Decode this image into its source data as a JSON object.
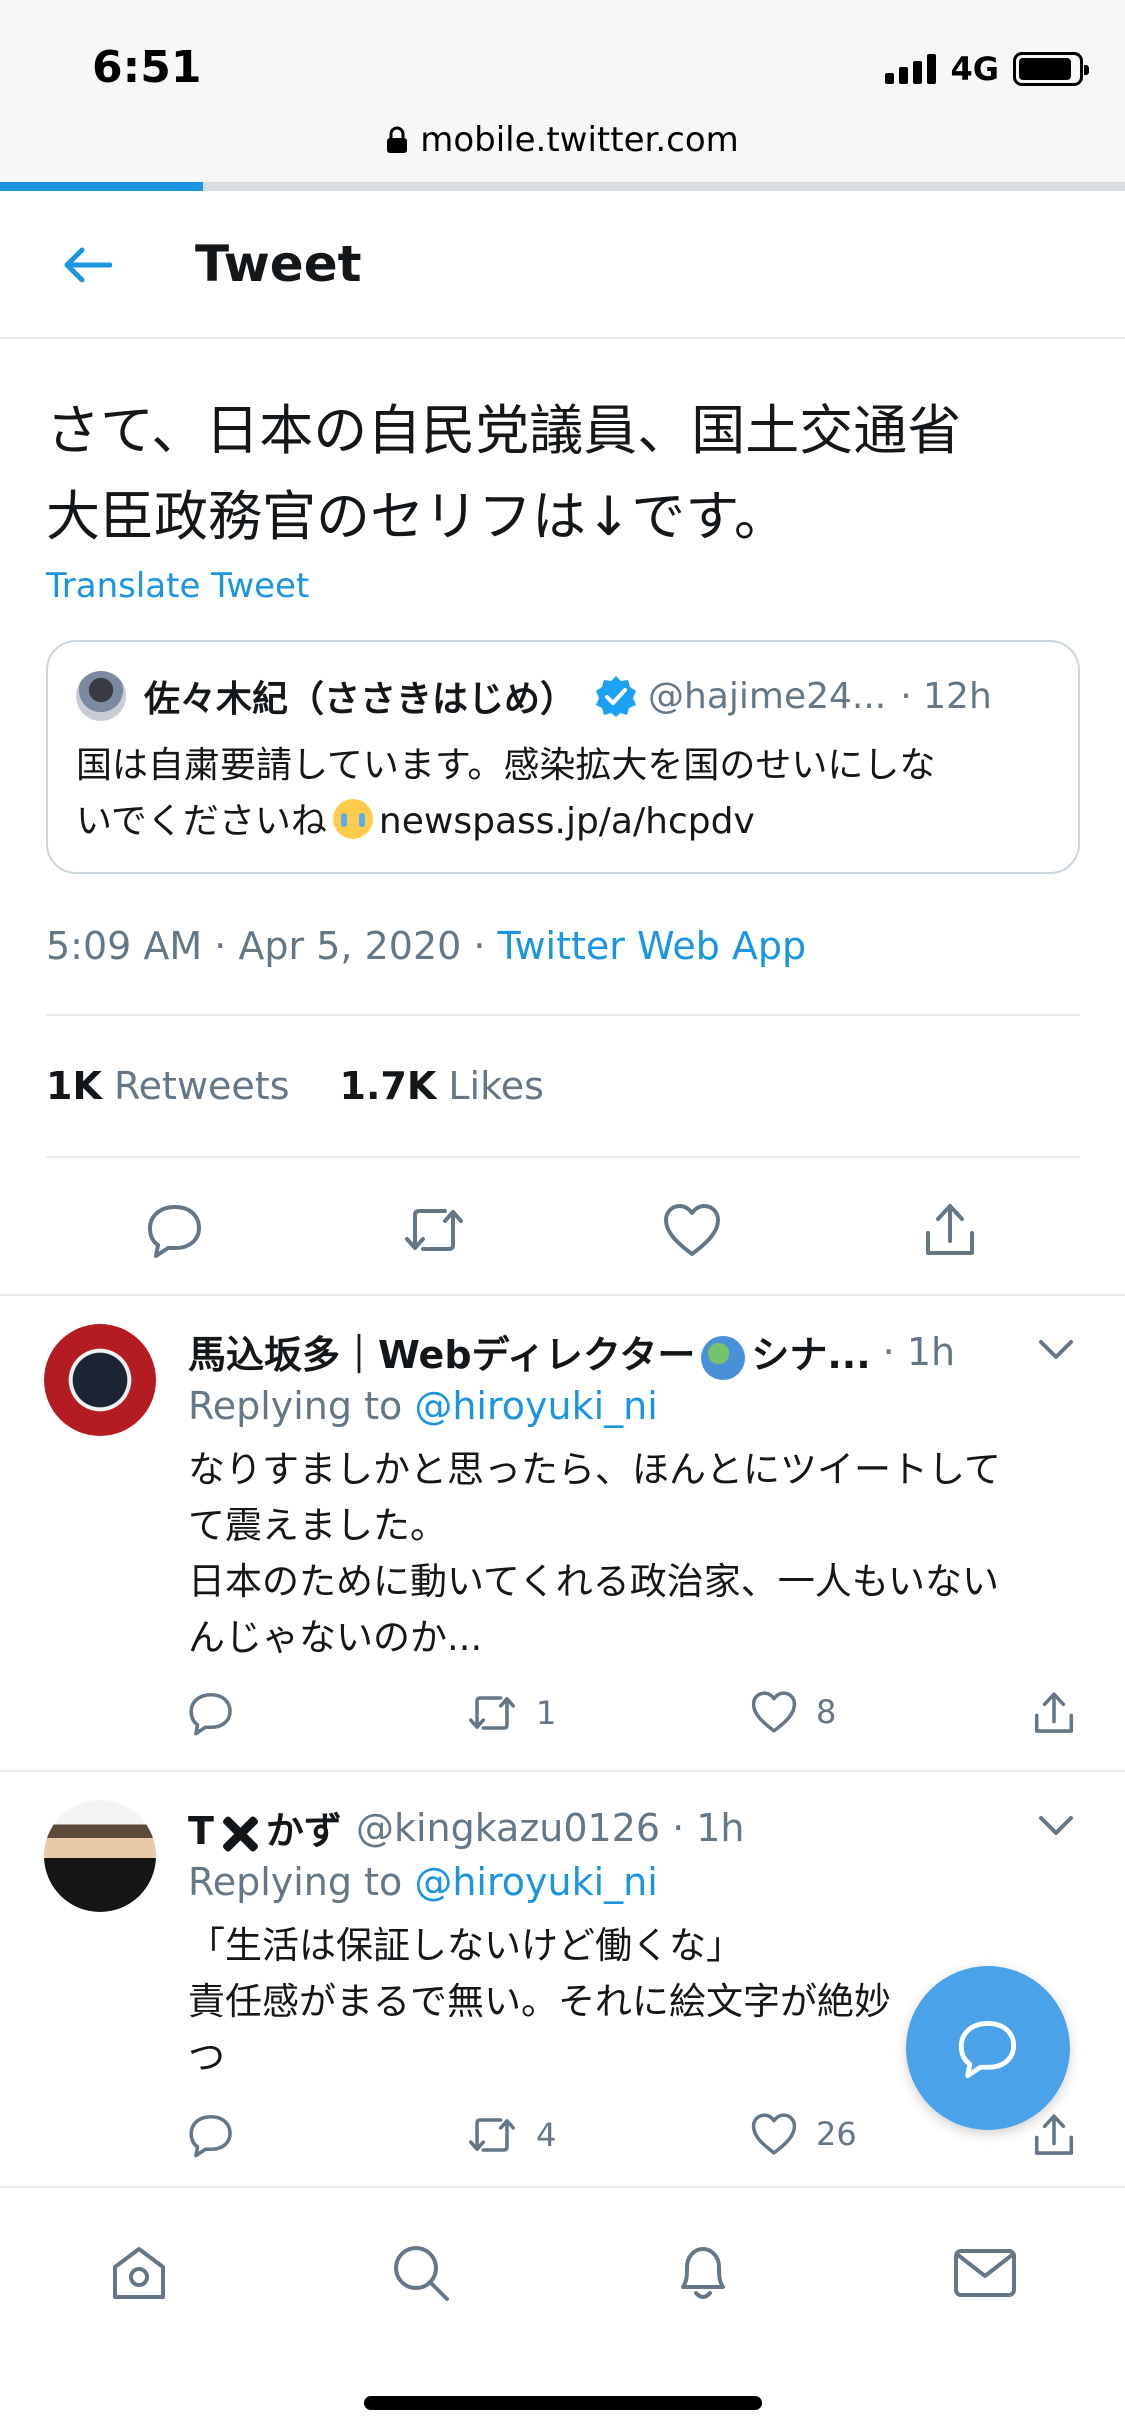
{
  "status_bar": {
    "time": "6:51",
    "network": "4G",
    "battery_level": 0.9
  },
  "browser": {
    "url": "mobile.twitter.com",
    "load_progress": 0.18
  },
  "header": {
    "title": "Tweet"
  },
  "tweet": {
    "text_line1": "さて、日本の自民党議員、国土交通省",
    "text_line2": "大臣政務官のセリフは↓です。",
    "translate_label": "Translate Tweet",
    "quote": {
      "name": "佐々木紀（ささきはじめ）",
      "handle": "@hajime24...",
      "time": "· 12h",
      "body_line1": "国は自粛要請しています。感染拡大を国のせいにしな",
      "body_line2_prefix": "いでくださいね",
      "link": "newspass.jp/a/hcpdv"
    },
    "timestamp": "5:09 AM · Apr 5, 2020 · ",
    "source_app": "Twitter Web App",
    "retweets_count": "1K",
    "retweets_label": "Retweets",
    "likes_count": "1.7K",
    "likes_label": "Likes"
  },
  "replies": [
    {
      "name_part1": "馬込坂多｜Webディレクター",
      "name_part2": "シナ...",
      "handle": "",
      "time": "· 1h",
      "replying_prefix": "Replying to ",
      "replying_to": "@hiroyuki_ni",
      "body": "なりすましかと思ったら、ほんとにツイートして\nて震えました。\n日本のために動いてくれる政治家、一人もいない\nんじゃないのか...",
      "retweets": "1",
      "likes": "8"
    },
    {
      "name_part1": "T",
      "name_part2": "かず",
      "handle": "@kingkazu0126",
      "time": "· 1h",
      "replying_prefix": "Replying to ",
      "replying_to": "@hiroyuki_ni",
      "body": "「生活は保証しないけど働くな」\n責任感がまるで無い。それに絵文字が絶妙\nつ",
      "retweets": "4",
      "likes": "26"
    }
  ],
  "icons": {
    "back": "arrow-left-icon",
    "reply": "reply-icon",
    "retweet": "retweet-icon",
    "like": "heart-icon",
    "share": "share-icon",
    "compose": "compose-reply-icon",
    "nav": [
      "home-icon",
      "search-icon",
      "notifications-icon",
      "messages-icon"
    ]
  },
  "colors": {
    "accent": "#1b95e0",
    "muted": "#657786",
    "text": "#14171a",
    "fab": "#4aa3e8"
  }
}
